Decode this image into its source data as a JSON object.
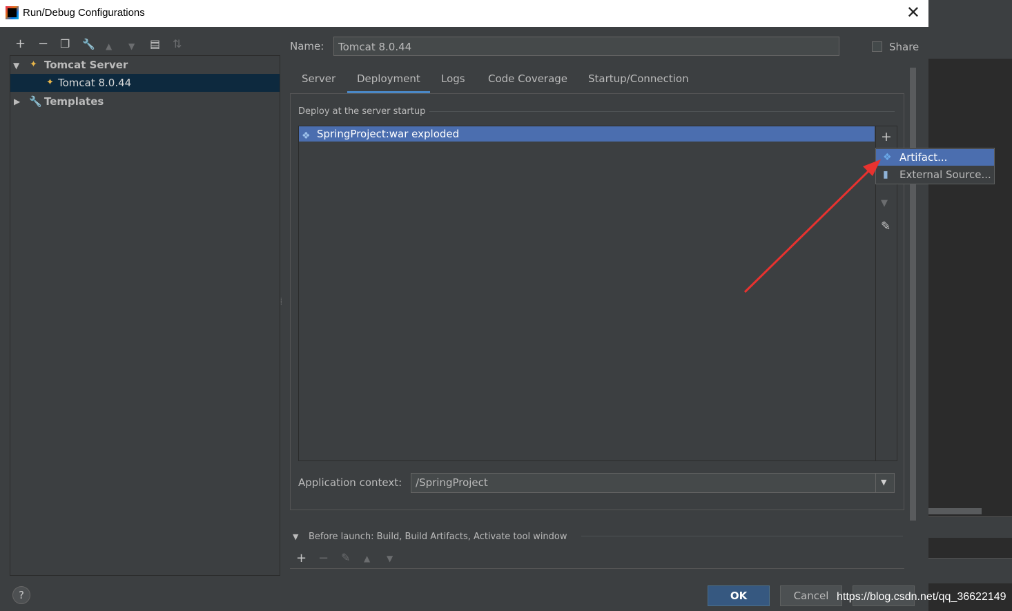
{
  "window": {
    "title": "Run/Debug Configurations",
    "close_glyph": "✕"
  },
  "toolbar": {
    "add": "+",
    "remove": "−",
    "copy": "❐",
    "edit": "🔧",
    "up": "▲",
    "down": "▼",
    "folder": "▤",
    "sort": "⇅"
  },
  "tree": {
    "items": [
      {
        "label": "Tomcat Server",
        "expanded": true
      },
      {
        "label": "Tomcat 8.0.44",
        "selected": true
      },
      {
        "label": "Templates",
        "expanded": false
      }
    ]
  },
  "form": {
    "name_label": "Name:",
    "name_value": "Tomcat 8.0.44",
    "share_label": "Share"
  },
  "tabs": [
    {
      "label": "Server"
    },
    {
      "label": "Deployment",
      "active": true
    },
    {
      "label": "Logs"
    },
    {
      "label": "Code Coverage"
    },
    {
      "label": "Startup/Connection"
    }
  ],
  "deployment": {
    "section_title": "Deploy at the server startup",
    "items": [
      {
        "label": "SpringProject:war exploded",
        "selected": true
      }
    ],
    "add_glyph": "+",
    "popup": [
      {
        "label": "Artifact...",
        "selected": true
      },
      {
        "label": "External Source..."
      }
    ],
    "context_label": "Application context:",
    "context_value": "/SpringProject"
  },
  "before_launch": {
    "title": "Before launch: Build, Build Artifacts, Activate tool window"
  },
  "buttons": {
    "help": "?",
    "ok": "OK",
    "cancel": "Cancel"
  },
  "watermark": "https://blog.csdn.net/qq_36622149",
  "colors": {
    "background": "#3c3f41",
    "selection": "#4b6eaf",
    "tree_selection": "#0d293e",
    "tab_accent": "#4a88c7",
    "ok_button": "#365880",
    "annotation_arrow": "#e8322f"
  }
}
